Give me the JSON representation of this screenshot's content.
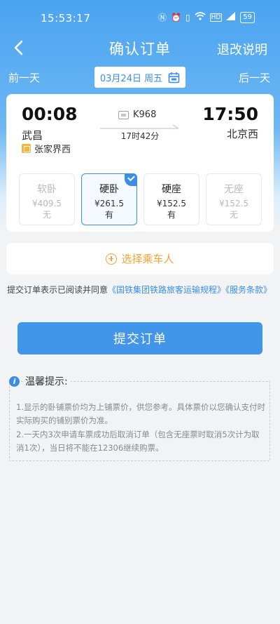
{
  "status_bar": {
    "time": "15:53:17",
    "battery": "59",
    "icons": [
      "nfc-icon",
      "alarm-icon",
      "vibrate-icon",
      "wifi-icon",
      "hd-icon",
      "signal-icon"
    ]
  },
  "nav": {
    "title": "确认订单",
    "right_label": "退改说明",
    "back_icon": "chevron-left-icon"
  },
  "date_bar": {
    "prev_label": "前一天",
    "next_label": "后一天",
    "date_text": "03月24日 周五"
  },
  "train": {
    "departure_time": "00:08",
    "arrival_time": "17:50",
    "departure_station": "武昌",
    "arrival_station": "北京西",
    "via_station": "张家界西",
    "train_number": "K968",
    "duration": "17时42分"
  },
  "seats": [
    {
      "name": "软卧",
      "price": "¥409.5",
      "availability": "无",
      "state": "disabled"
    },
    {
      "name": "硬卧",
      "price": "¥261.5",
      "availability": "有",
      "state": "selected"
    },
    {
      "name": "硬座",
      "price": "¥152.5",
      "availability": "有",
      "state": "available"
    },
    {
      "name": "无座",
      "price": "¥152.5",
      "availability": "无",
      "state": "disabled"
    }
  ],
  "passenger": {
    "label": "选择乘车人"
  },
  "agreement": {
    "prefix": "提交订单表示已阅读并同意",
    "link1": "《国铁集团铁路旅客运输规程》",
    "link2": "《服务条款》"
  },
  "submit": {
    "label": "提交订单"
  },
  "tips": {
    "title": "温馨提示:",
    "line1": "1.显示的卧铺票价均为上铺票价，供您参考。具体票价以您确认支付时实际购买的铺别票价为准。",
    "line2": "2.一天内3次申请车票成功后取消订单（包含无座票时取消5次计为取消1次），当日将不能在12306继续购票。"
  },
  "colors": {
    "primary": "#4296ea",
    "accent_orange": "#f0a533",
    "link": "#3a8ee6"
  }
}
